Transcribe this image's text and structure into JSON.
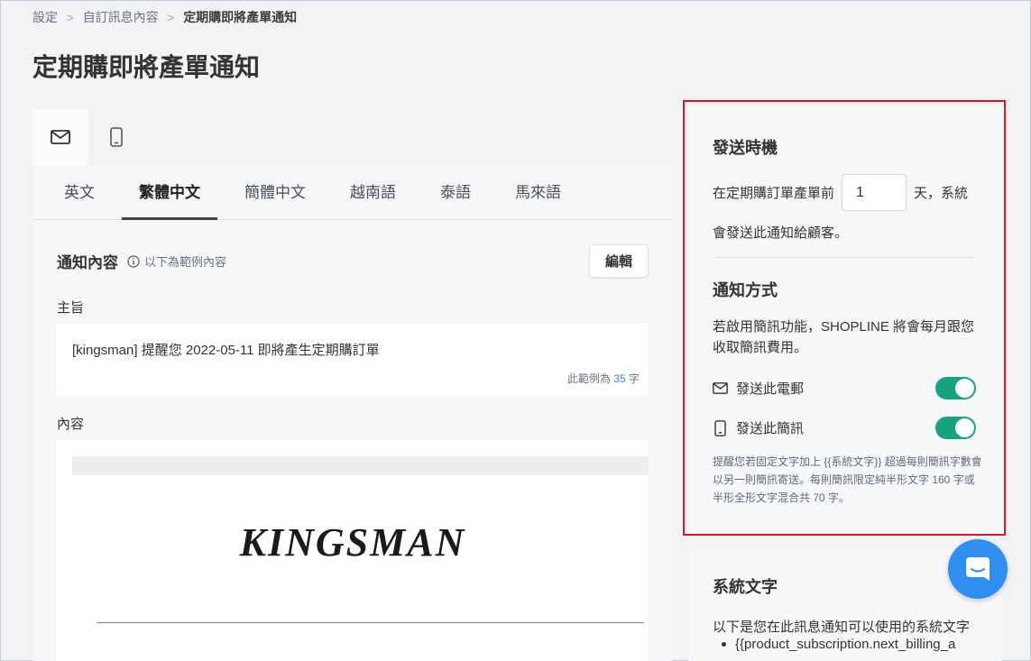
{
  "breadcrumb": {
    "items": [
      "設定",
      "自訂訊息內容",
      "定期購即將產單通知"
    ]
  },
  "page": {
    "title": "定期購即將產單通知"
  },
  "channel_tabs": [
    {
      "icon": "mail-icon",
      "active": true
    },
    {
      "icon": "phone-icon",
      "active": false
    }
  ],
  "language_tabs": [
    "英文",
    "繁體中文",
    "簡體中文",
    "越南語",
    "泰語",
    "馬來語"
  ],
  "active_language": "繁體中文",
  "notice": {
    "title": "通知內容",
    "hint": "以下為範例內容",
    "edit_label": "編輯",
    "subject_label": "主旨",
    "subject_text": "[kingsman] 提醒您 2022-05-11 即將產生定期購訂單",
    "count_prefix": "此範例為",
    "count_value": "35",
    "count_suffix": "字",
    "content_label": "內容",
    "brand": "KINGSMAN"
  },
  "send_timing": {
    "title": "發送時機",
    "prefix": "在定期購訂單產單前",
    "days_value": "1",
    "suffix": "天，系統",
    "line2": "會發送此通知給顧客。"
  },
  "notify_method": {
    "title": "通知方式",
    "desc": "若啟用簡訊功能，SHOPLINE 將會每月跟您收取簡訊費用。",
    "email_label": "發送此電郵",
    "email_enabled": true,
    "sms_label": "發送此簡訊",
    "sms_enabled": true,
    "sms_note": "提醒您若固定文字加上 {{系統文字}} 超過每則簡訊字數會以另一則簡訊寄送。每則簡訊限定純半形文字 160 字或半形全形文字混合共 70 字。"
  },
  "system_vars": {
    "title": "系統文字",
    "desc": "以下是您在此訊息通知可以使用的系統文字",
    "items": [
      "{{product_subscription.next_billing_a"
    ]
  },
  "colors": {
    "toggle_on": "#16a37f",
    "highlight": "#e0141e",
    "chat_button": "#2f8ff0",
    "link_blue": "#3b7dd8"
  }
}
